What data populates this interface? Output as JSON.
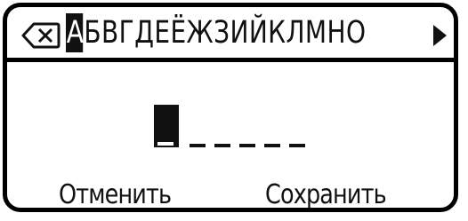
{
  "keyboard": {
    "backspace_icon": "backspace-icon",
    "letters": [
      "А",
      "Б",
      "В",
      "Г",
      "Д",
      "Е",
      "Ё",
      "Ж",
      "З",
      "И",
      "Й",
      "К",
      "Л",
      "М",
      "Н",
      "О"
    ],
    "selected_index": 0,
    "next_icon": "arrow-right-icon"
  },
  "code": {
    "slots_total": 6,
    "active_slot": 0
  },
  "buttons": {
    "cancel_label": "Отменить",
    "save_label": "Сохранить"
  }
}
